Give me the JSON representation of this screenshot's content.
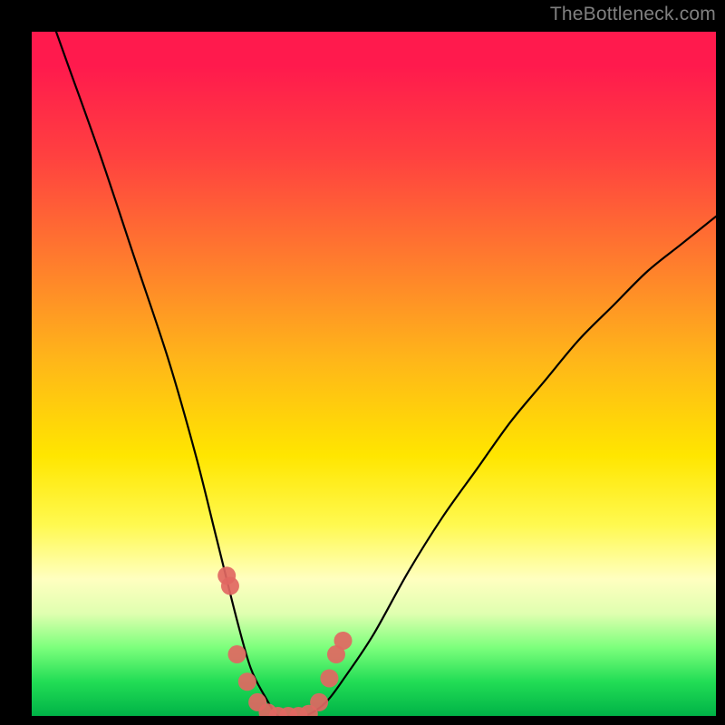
{
  "watermark": "TheBottleneck.com",
  "chart_data": {
    "type": "line",
    "title": "",
    "xlabel": "",
    "ylabel": "",
    "xlim": [
      0,
      100
    ],
    "ylim": [
      0,
      100
    ],
    "grid": false,
    "series": [
      {
        "name": "bottleneck-curve",
        "x": [
          0,
          5,
          10,
          15,
          20,
          24,
          27,
          30,
          32,
          34,
          36,
          38,
          40,
          43,
          46,
          50,
          55,
          60,
          65,
          70,
          75,
          80,
          85,
          90,
          95,
          100
        ],
        "values": [
          110,
          96,
          82,
          67,
          52,
          38,
          26,
          14,
          7,
          3,
          0,
          0,
          0,
          2,
          6,
          12,
          21,
          29,
          36,
          43,
          49,
          55,
          60,
          65,
          69,
          73
        ]
      }
    ],
    "markers": {
      "name": "highlighted-points",
      "color": "#e16762",
      "x": [
        28.5,
        29.0,
        30.0,
        31.5,
        33.0,
        34.5,
        36.0,
        37.5,
        39.0,
        40.5,
        42.0,
        43.5,
        44.5,
        45.5
      ],
      "values": [
        20.5,
        19.0,
        9.0,
        5.0,
        2.0,
        0.5,
        0.0,
        0.0,
        0.0,
        0.3,
        2.0,
        5.5,
        9.0,
        11.0
      ]
    },
    "background_gradient": {
      "stops": [
        {
          "pos": 0.0,
          "color": "#ff1a4d"
        },
        {
          "pos": 0.05,
          "color": "#ff1a4d"
        },
        {
          "pos": 0.18,
          "color": "#ff4040"
        },
        {
          "pos": 0.33,
          "color": "#ff7a2e"
        },
        {
          "pos": 0.48,
          "color": "#ffb619"
        },
        {
          "pos": 0.62,
          "color": "#ffe600"
        },
        {
          "pos": 0.72,
          "color": "#fff94f"
        },
        {
          "pos": 0.8,
          "color": "#ffffc0"
        },
        {
          "pos": 0.85,
          "color": "#e0ffb0"
        },
        {
          "pos": 0.9,
          "color": "#7cff7c"
        },
        {
          "pos": 0.95,
          "color": "#22dd55"
        },
        {
          "pos": 1.0,
          "color": "#00b347"
        }
      ]
    }
  }
}
